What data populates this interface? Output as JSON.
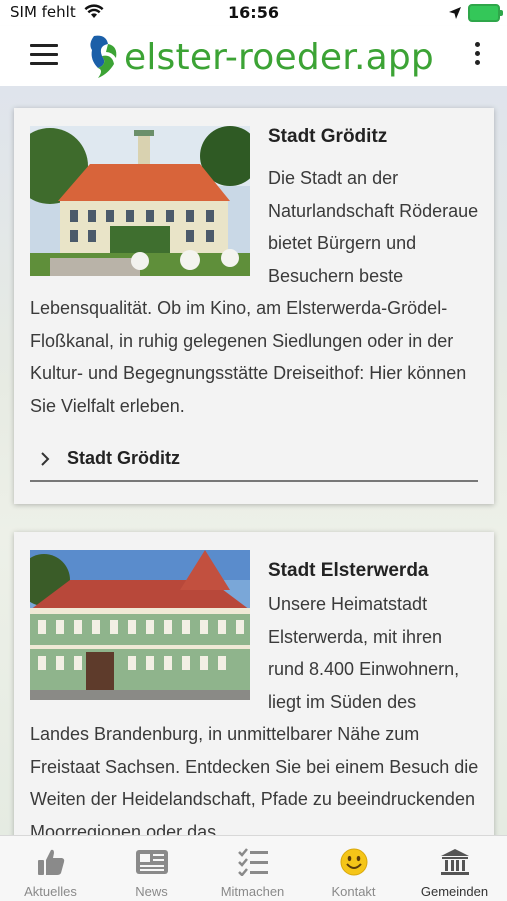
{
  "status_bar": {
    "carrier": "SIM fehlt",
    "time": "16:56"
  },
  "header": {
    "logo_text": "elster-roeder.app",
    "logo_color": "#3ca335"
  },
  "cards": [
    {
      "title": "Stadt Gröditz",
      "text": "Die Stadt an der Naturlandschaft Röderaue bietet Bürgern und Besuchern beste Lebensqualität. Ob im Kino, am Elsterwerda-Grödel-Floßkanal, in ruhig gelegenen Siedlungen oder in der Kultur- und Begegnungsstätte Dreiseithof: Hier können Sie Vielfalt erleben.",
      "link_label": "Stadt Gröditz"
    },
    {
      "title": "Stadt Elsterwerda",
      "text": "Unsere Heimatstadt Elsterwerda, mit ihren rund 8.400 Einwohnern, liegt im Süden des Landes Brandenburg, in unmittelbarer Nähe zum Freistaat Sachsen. Entdecken Sie bei einem Besuch die Weiten der Heidelandschaft, Pfade zu beeindruckenden Moorregionen oder das"
    }
  ],
  "tabs": [
    {
      "label": "Aktuelles",
      "icon": "thumbs-up-icon"
    },
    {
      "label": "News",
      "icon": "newspaper-icon"
    },
    {
      "label": "Mitmachen",
      "icon": "checklist-icon"
    },
    {
      "label": "Kontakt",
      "icon": "smiley-icon"
    },
    {
      "label": "Gemeinden",
      "icon": "building-icon"
    }
  ],
  "colors": {
    "accent": "#3ca335",
    "battery": "#34c759",
    "smiley": "#f5c518"
  }
}
